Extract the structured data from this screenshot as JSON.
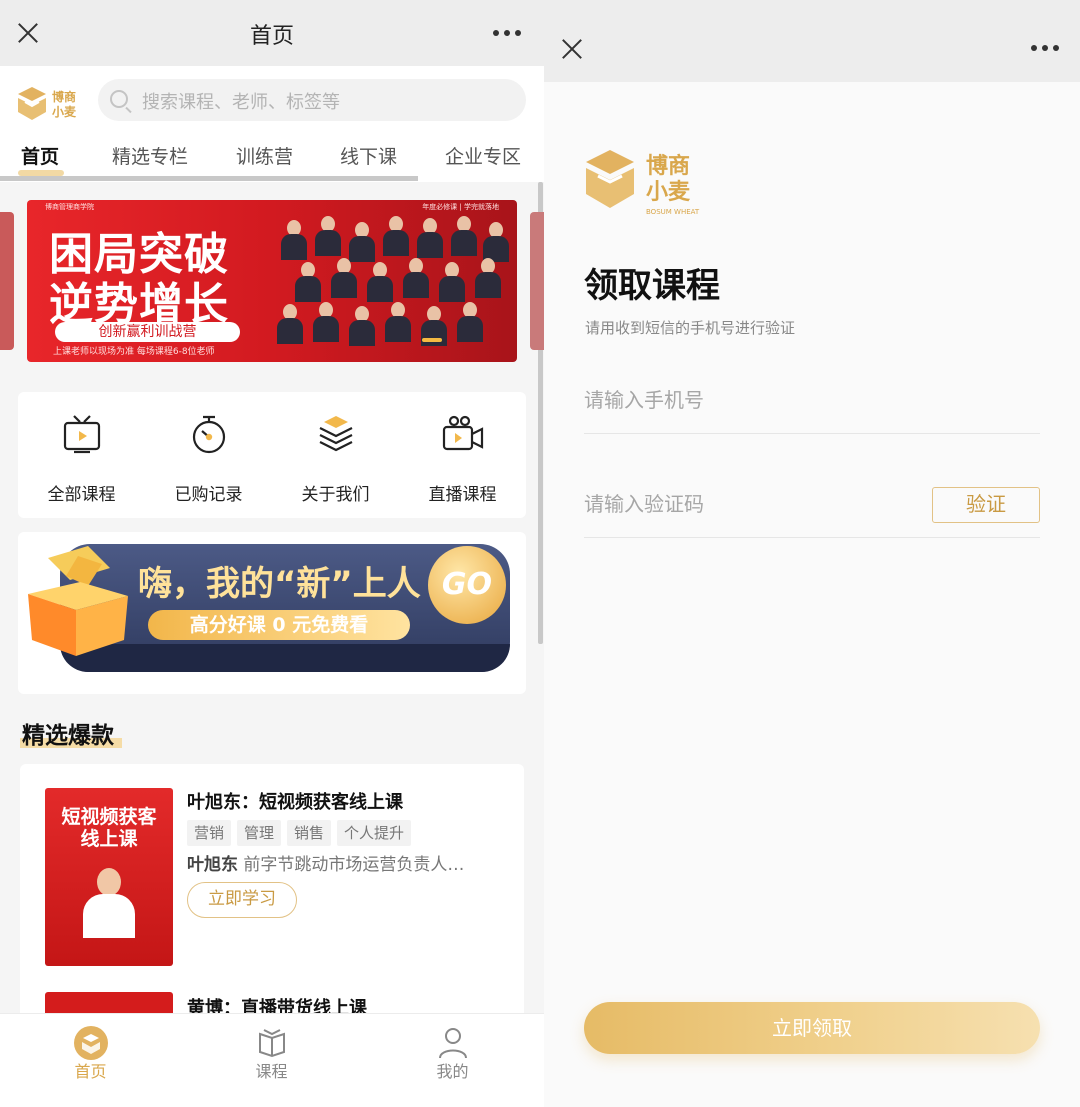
{
  "left": {
    "topbar": {
      "title": "首页"
    },
    "search": {
      "placeholder": "搜索课程、老师、标签等"
    },
    "tabs": [
      {
        "label": "首页"
      },
      {
        "label": "精选专栏"
      },
      {
        "label": "训练营"
      },
      {
        "label": "线下课"
      },
      {
        "label": "企业专区"
      }
    ],
    "banner": {
      "top_left": "博商管理商学院",
      "top_right": "年度必修课 | 学完就落地",
      "headline_1": "困局突破",
      "headline_2": "逆势增长",
      "subline": "创新赢利训战营",
      "note": "上课老师以现场为准 每场课程6-8位老师"
    },
    "quick_links": [
      {
        "label": "全部课程",
        "icon": "tv-icon"
      },
      {
        "label": "已购记录",
        "icon": "stopwatch-icon"
      },
      {
        "label": "关于我们",
        "icon": "brand-stack-icon"
      },
      {
        "label": "直播课程",
        "icon": "camera-icon"
      }
    ],
    "promo": {
      "headline": "嗨，我的“新”上人",
      "sub": "高分好课 0 元免费看",
      "go": "GO"
    },
    "section_title": "精选爆款",
    "courses": [
      {
        "title": "叶旭东：短视频获客线上课",
        "tags": [
          "营销",
          "管理",
          "销售",
          "个人提升"
        ],
        "teacher": "叶旭东",
        "desc": "前字节跳动市场运营负责人…",
        "button": "立即学习",
        "cover_title": "短视频获客线上课"
      },
      {
        "title": "黄博：直播带货线上课"
      }
    ],
    "tabbar": [
      {
        "label": "首页",
        "icon": "home-brand-icon",
        "active": true
      },
      {
        "label": "课程",
        "icon": "book-icon",
        "active": false
      },
      {
        "label": "我的",
        "icon": "user-icon",
        "active": false
      }
    ]
  },
  "right": {
    "title": "领取课程",
    "subtitle": "请用收到短信的手机号进行验证",
    "phone_placeholder": "请输入手机号",
    "code_placeholder": "请输入验证码",
    "verify_button": "验证",
    "submit_button": "立即领取",
    "logo_text_1": "博商",
    "logo_text_2": "小麦",
    "logo_text_3": "BOSUM WHEAT"
  },
  "colors": {
    "brand_gold": "#e2b260",
    "banner_red": "#d21a20",
    "promo_navy": "#2f3a5e"
  }
}
